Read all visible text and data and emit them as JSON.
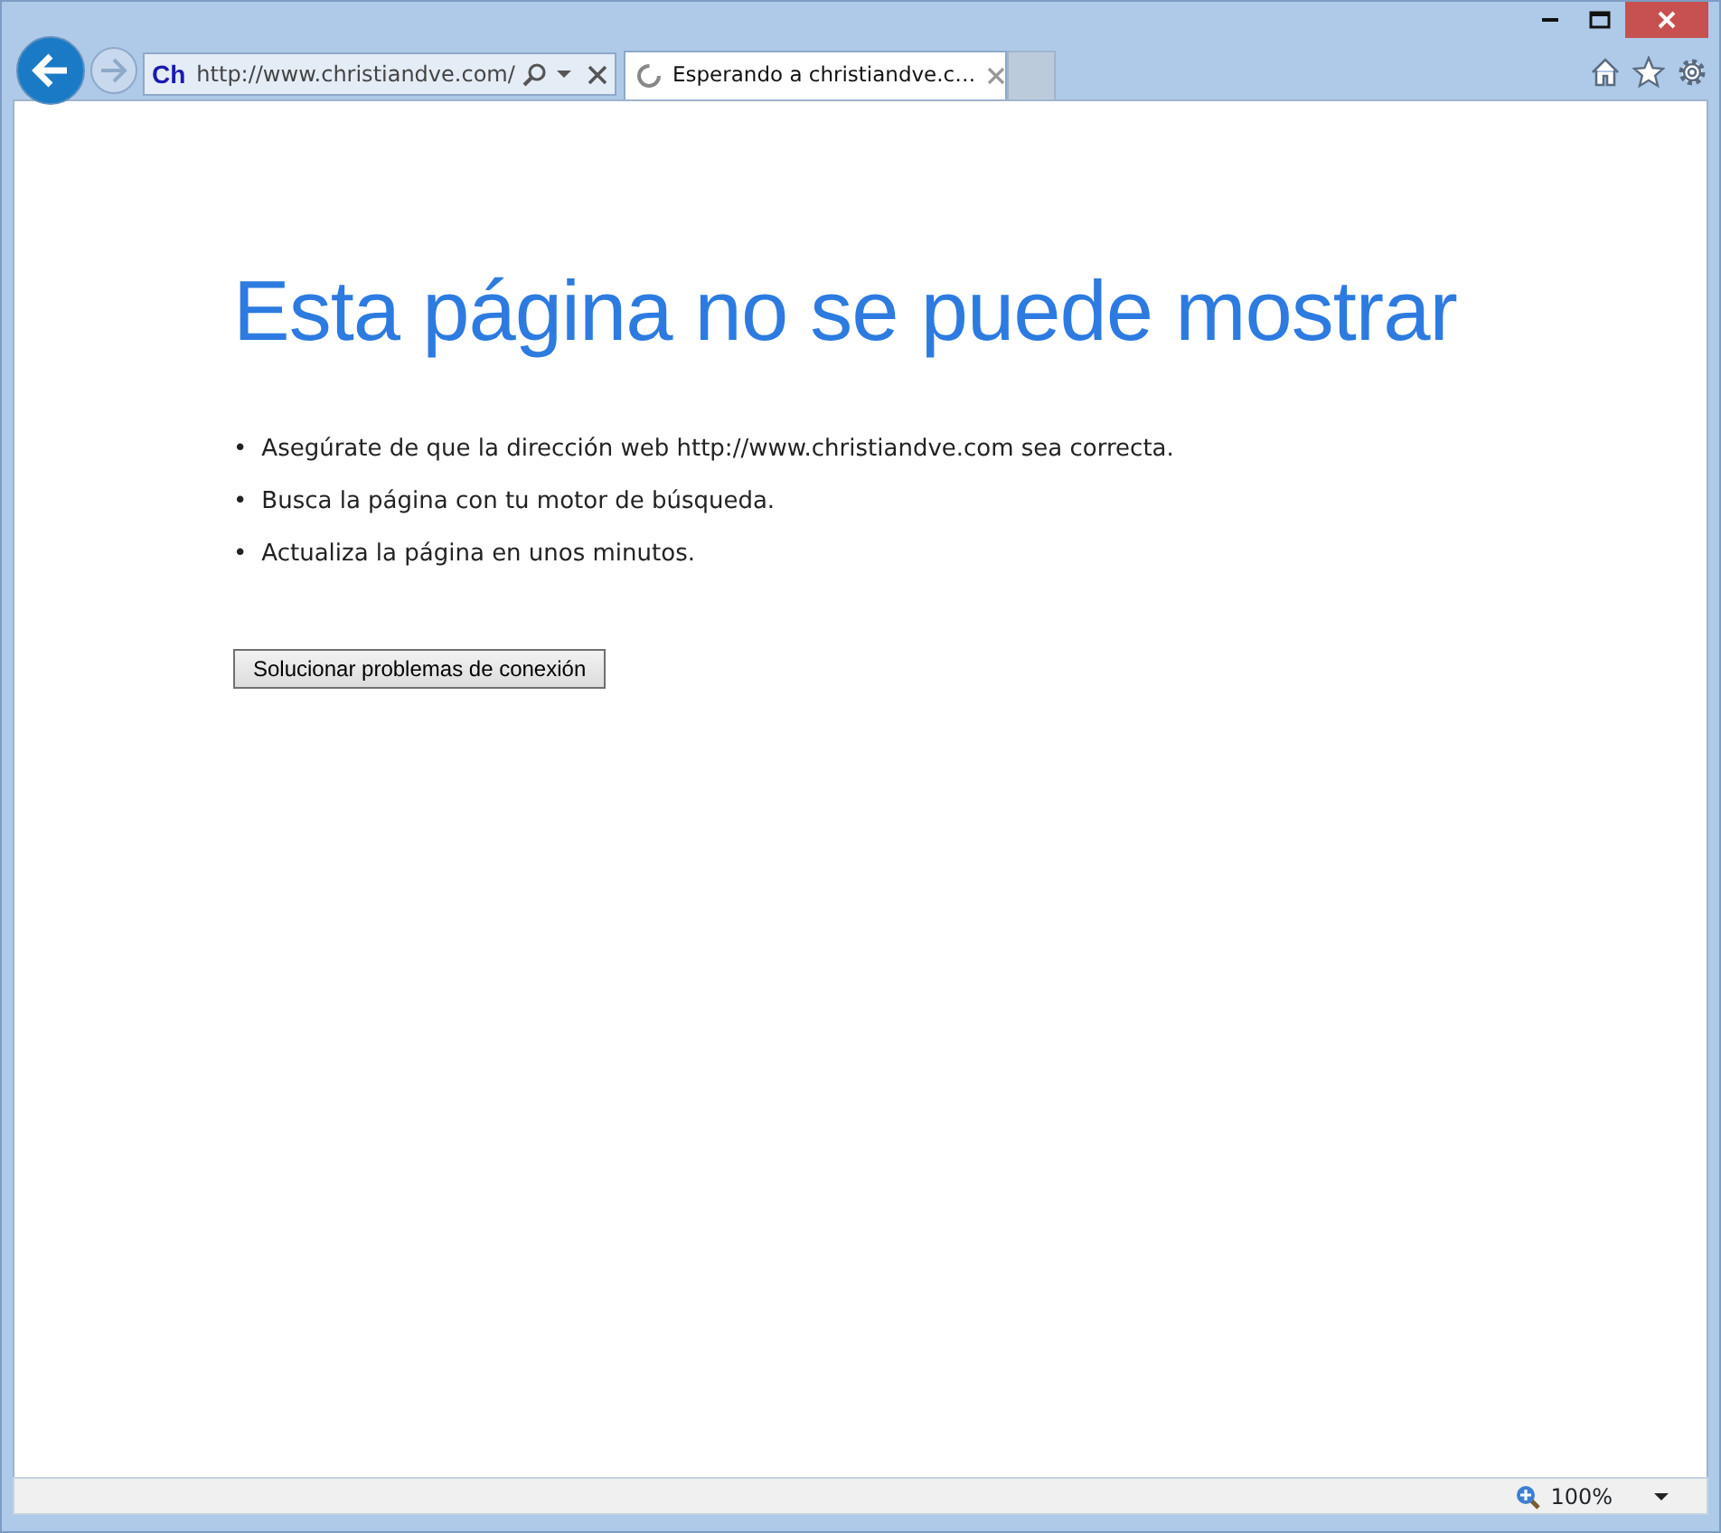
{
  "address_bar": {
    "favicon": "Ch",
    "url": "http://www.christiandve.com/"
  },
  "tabs": [
    {
      "title": "Esperando a christiandve.c…",
      "selected": true,
      "loading": true
    }
  ],
  "page": {
    "heading": "Esta página no se puede mostrar",
    "items": [
      {
        "bullet": "•",
        "text": "Asegúrate de que la dirección web http://www.christiandve.com sea correcta."
      },
      {
        "bullet": "•",
        "text": "Busca la página con tu motor de búsqueda."
      },
      {
        "bullet": "•",
        "text": "Actualiza la página en unos minutos."
      }
    ],
    "button": "Solucionar problemas de conexión"
  },
  "status_bar": {
    "zoom": "100%"
  }
}
